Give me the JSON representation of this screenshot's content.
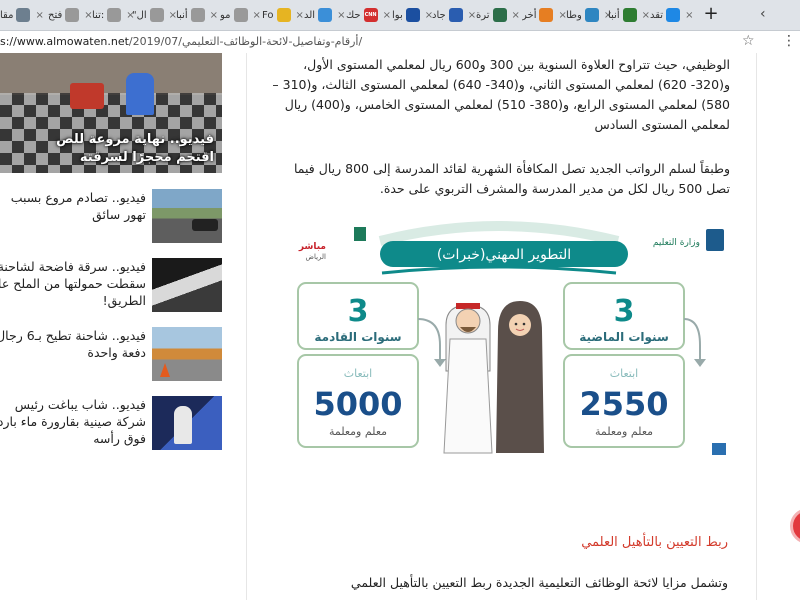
{
  "browser": {
    "tabs": [
      {
        "label": "مقا",
        "fav_color": "#6d7f8f"
      },
      {
        "label": "فتح",
        "fav_color": "#999999"
      },
      {
        "label": "تنا:",
        "fav_color": "#999999"
      },
      {
        "label": "\"ال",
        "fav_color": "#999999"
      },
      {
        "label": "أنبا",
        "fav_color": "#999999"
      },
      {
        "label": "مو",
        "fav_color": "#999999"
      },
      {
        "label": "Fo",
        "fav_color": "#e6b422"
      },
      {
        "label": "الد",
        "fav_color": "#3b8fd8"
      },
      {
        "label": "حك",
        "fav_color": "#d32f2f",
        "fav_text": "CNN"
      },
      {
        "label": "بوا",
        "fav_color": "#1b4fa0"
      },
      {
        "label": "جاد",
        "fav_color": "#2a5db0"
      },
      {
        "label": "ترة",
        "fav_color": "#2c6e49"
      },
      {
        "label": "أخر",
        "fav_color": "#e67e22"
      },
      {
        "label": "وطا",
        "fav_color": "#2e86c1"
      },
      {
        "label": "أنبا",
        "fav_color": "#2e7d32"
      },
      {
        "label": "تقد",
        "fav_color": "#1e88e5"
      }
    ],
    "new_tab_symbol": "+",
    "url_domain": "s://www.almowaten.net",
    "url_path": "/2019/07/أرقام-وتفاصيل-لائحة-الوظائف-التعليمي/"
  },
  "sidebar": {
    "featured_caption": "فيديو.. نهاية مروعة للص اقتحم محجرًا لسرقته",
    "news": [
      {
        "title": "فيديو.. تصادم مروع بسبب تهور سائق"
      },
      {
        "title": "فيديو.. سرقة فاضحة لشاحنة سقطت حمولتها من الملح على الطريق!"
      },
      {
        "title": "فيديو.. شاحنة تطيح بـ6 رجال دفعة واحدة"
      },
      {
        "title": "فيديو.. شاب يباغت رئيس شركة صينية بقارورة ماء باردة فوق رأسه"
      }
    ]
  },
  "article": {
    "para1": "الوظيفي، حيث تتراوح العلاوة السنوية بين 300 و600 ريال لمعلمي المستوى الأول، و(320- 620) لمعلمي المستوى الثاني، و(340- 640) لمعلمي المستوى الثالث، و(310 – 580) لمعلمي المستوى الرابع، و(380- 510) لمعلمي المستوى الخامس، و(400) ريال لمعلمي المستوى السادس",
    "para2": "وطبقاً لسلم الرواتب الجديد تصل المكافأة الشهرية لقائد المدرسة إلى 800 ريال فيما تصل 500 ريال لكل من مدير المدرسة والمشرف التربوي على حدة.",
    "subheading": "ربط التعيين بالتأهيل العلمي",
    "para3": "وتشمل مزايا لائحة الوظائف التعليمية الجديدة ربط التعيين بالتأهيل العلمي"
  },
  "infographic": {
    "title": "التطوير المهني(خبرات)",
    "channel_label": "مباشر",
    "channel_city": "الرياض",
    "ministry_label": "وزارة التعليم",
    "left": {
      "years_number": "3",
      "years_label": "سنوات القادمة",
      "count_label": "ابتعاث",
      "count_value": "5000",
      "count_sub": "معلم ومعلمة"
    },
    "right": {
      "years_number": "3",
      "years_label": "سنوات الماضية",
      "count_label": "ابتعاث",
      "count_value": "2550",
      "count_sub": "معلم ومعلمة"
    },
    "accent_color": "#0e8a8a",
    "number_color": "#1a4f8a"
  }
}
